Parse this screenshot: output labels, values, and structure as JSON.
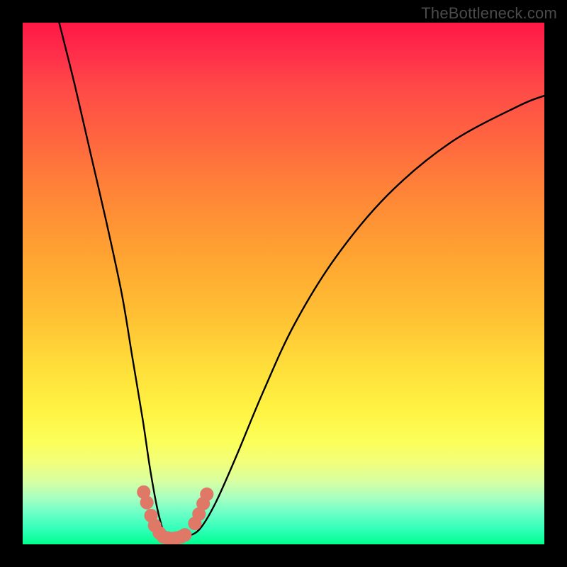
{
  "watermark": "TheBottleneck.com",
  "chart_data": {
    "type": "line",
    "title": "",
    "xlabel": "",
    "ylabel": "",
    "xlim": [
      0,
      100
    ],
    "ylim": [
      0,
      100
    ],
    "grid": false,
    "series": [
      {
        "name": "bottleneck-curve",
        "x": [
          7,
          10,
          13,
          16,
          19,
          21,
          23,
          24.5,
          26,
          27.5,
          29.5,
          31.5,
          34,
          37,
          41,
          46,
          52,
          60,
          70,
          82,
          95,
          100
        ],
        "values": [
          100,
          88,
          75,
          62,
          48,
          36,
          24,
          14,
          6,
          1.5,
          1.2,
          1.5,
          3,
          8,
          17,
          29,
          42,
          55,
          67,
          77,
          84,
          86
        ]
      }
    ],
    "markers": [
      {
        "x": 23.2,
        "y": 10.0,
        "r": 1.3
      },
      {
        "x": 23.8,
        "y": 8.0,
        "r": 1.3
      },
      {
        "x": 24.6,
        "y": 5.5,
        "r": 1.3
      },
      {
        "x": 25.3,
        "y": 3.6,
        "r": 1.3
      },
      {
        "x": 26.2,
        "y": 2.2,
        "r": 1.3
      },
      {
        "x": 27.0,
        "y": 1.4,
        "r": 1.3
      },
      {
        "x": 27.8,
        "y": 1.2,
        "r": 1.3
      },
      {
        "x": 28.7,
        "y": 1.1,
        "r": 1.3
      },
      {
        "x": 29.5,
        "y": 1.2,
        "r": 1.3
      },
      {
        "x": 30.3,
        "y": 1.4,
        "r": 1.3
      },
      {
        "x": 31.1,
        "y": 1.8,
        "r": 1.3
      },
      {
        "x": 33.0,
        "y": 4.0,
        "r": 1.3
      },
      {
        "x": 33.8,
        "y": 5.8,
        "r": 1.3
      },
      {
        "x": 34.6,
        "y": 7.8,
        "r": 1.3
      },
      {
        "x": 35.3,
        "y": 9.6,
        "r": 1.3
      }
    ],
    "background_gradient": {
      "top": "#ff1846",
      "mid": "#ffde3a",
      "bottom": "#00ff90"
    }
  }
}
